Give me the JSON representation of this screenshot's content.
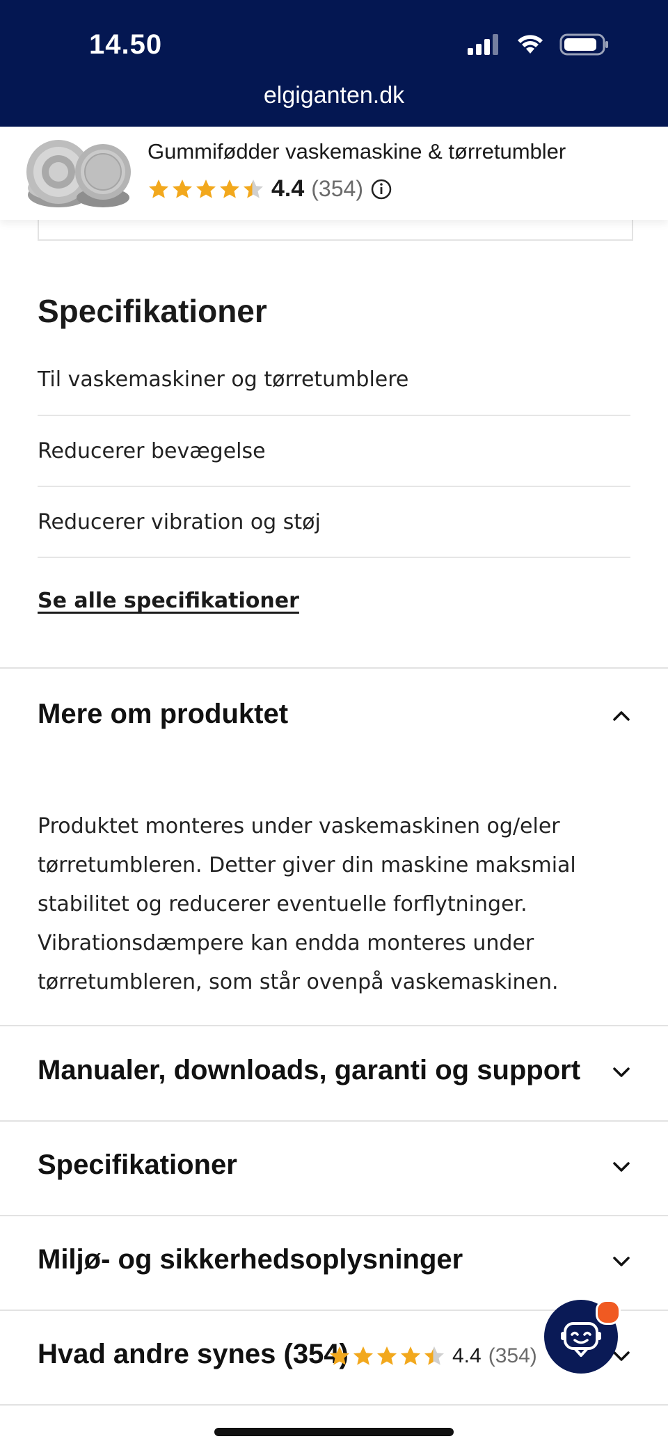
{
  "status_bar": {
    "time": "14.50",
    "url": "elgiganten.dk"
  },
  "product": {
    "title": "Gummifødder vaskemaskine & tørretumbler",
    "rating": "4.4",
    "review_count": "(354)",
    "stars": 4.4
  },
  "specs": {
    "title": "Specifikationer",
    "items": [
      "Til vaskemaskiner og tørretumblere",
      "Reducerer bevægelse",
      "Reducerer vibration og støj"
    ],
    "see_all": "Se alle specifikationer"
  },
  "more": {
    "title": "Mere om produktet",
    "lines": [
      "Produktet monteres under vaskemaskinen og/eler",
      "tørretumbleren. Detter giver din maskine maksmial",
      "stabilitet og reducerer eventuelle forflytninger.",
      "Vibrationsdæmpere kan endda monteres under",
      "tørretumbleren, som står ovenpå vaskemaskinen."
    ]
  },
  "accordions": {
    "manuals": "Manualer, downloads, garanti og support",
    "specs": "Specifikationer",
    "env": "Miljø- og sikkerhedsoplysninger",
    "reviews": "Hvad andre synes (354)"
  },
  "review_summary": {
    "rating": "4.4",
    "count": "(354)"
  },
  "colors": {
    "brand": "#041752",
    "star": "#f2a81d",
    "badge": "#f05a22"
  },
  "icons": [
    "signal-icon",
    "wifi-icon",
    "battery-icon",
    "info-icon",
    "chevron-up-icon",
    "chevron-down-icon",
    "chatbot-icon"
  ]
}
